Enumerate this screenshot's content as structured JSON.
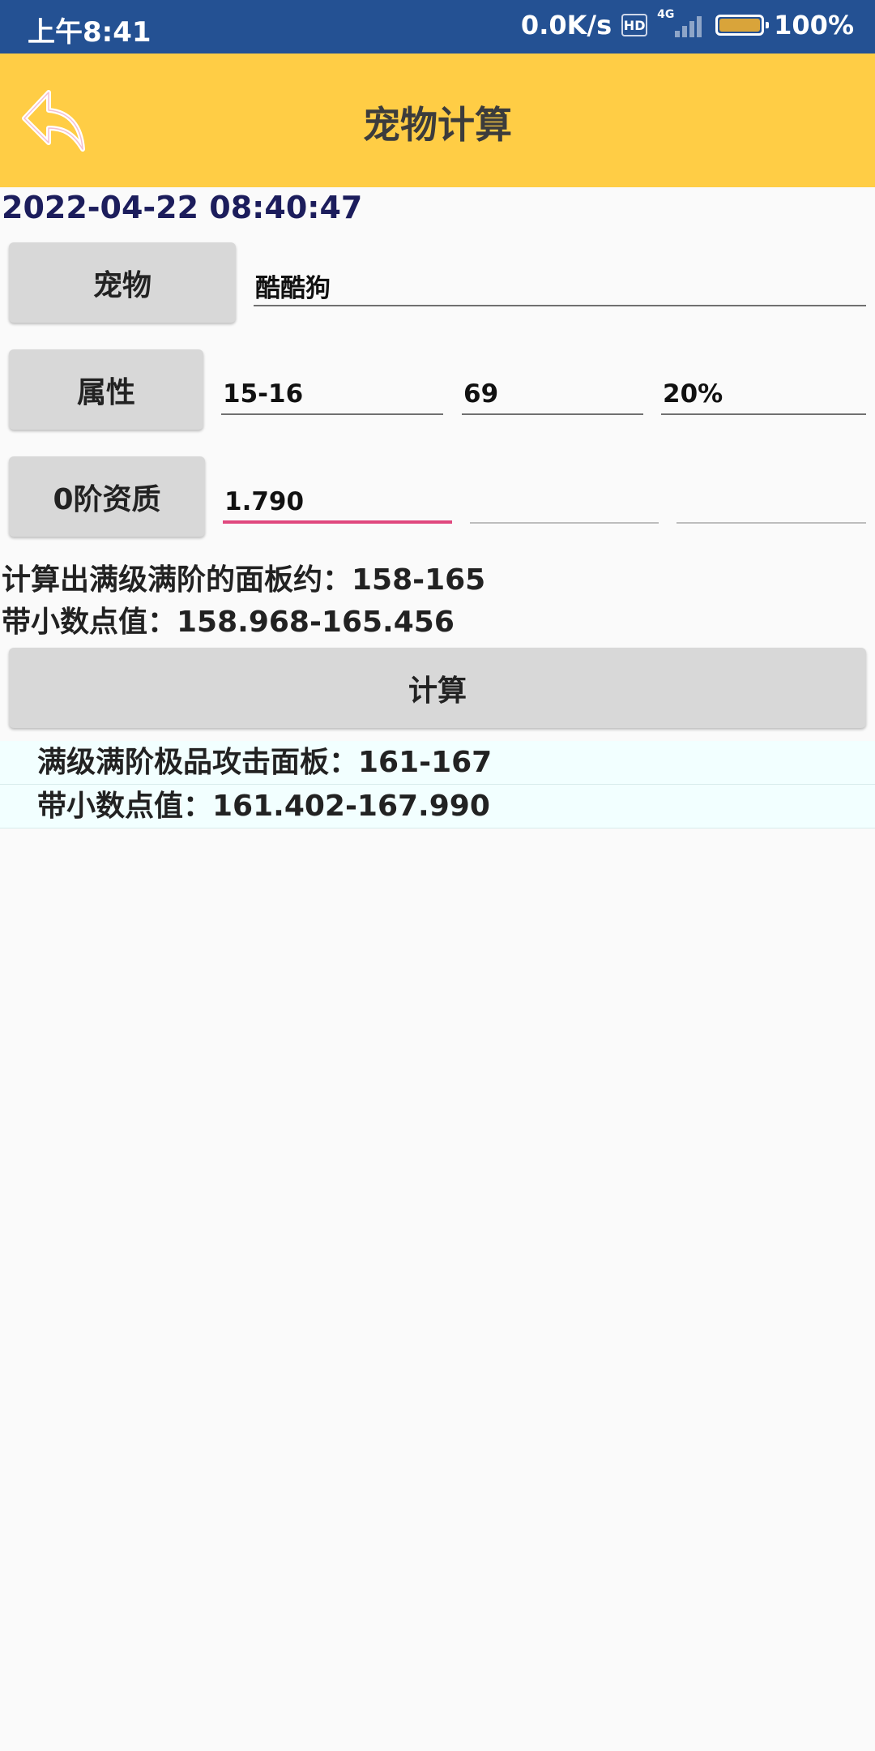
{
  "status_bar": {
    "time": "上午8:41",
    "network_speed": "0.0K/s",
    "hd_badge": "HD",
    "network_type": "4G",
    "battery_percent": "100%",
    "battery_level": 1.0
  },
  "app_bar": {
    "title": "宠物计算",
    "back_icon": "back-arrow-icon"
  },
  "timestamp": "2022-04-22 08:40:47",
  "pet": {
    "label": "宠物",
    "value": "酷酷狗"
  },
  "attributes": {
    "label": "属性",
    "values": [
      "15-16",
      "69",
      "20%"
    ]
  },
  "aptitude": {
    "label": "0阶资质",
    "values": [
      "1.790",
      "",
      ""
    ]
  },
  "results": {
    "panel": "计算出满级满阶的面板约：158-165",
    "decimal": "带小数点值：158.968-165.456"
  },
  "calculate_button": "计算",
  "list": [
    "满级满阶极品攻击面板：161-167",
    "带小数点值：161.402-167.990"
  ],
  "colors": {
    "status_bar": "#245193",
    "app_bar": "#ffcd45",
    "timestamp": "#1c1d5c",
    "focus_underline": "#e0487e",
    "list_background": "#f2ffff"
  }
}
